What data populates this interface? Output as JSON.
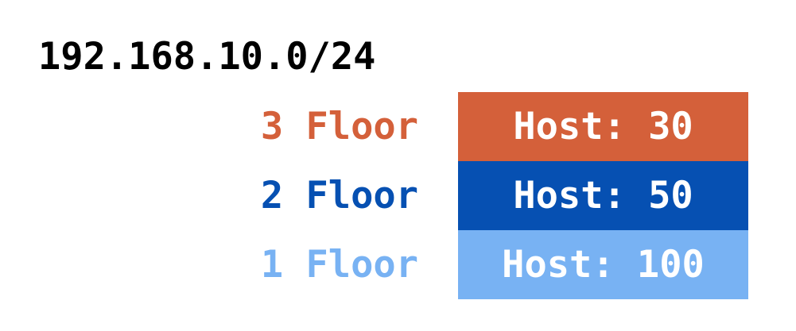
{
  "network": {
    "cidr": "192.168.10.0/24"
  },
  "floors": [
    {
      "label": "3 Floor",
      "host_text": "Host: 30",
      "color": "#d4603a"
    },
    {
      "label": "2 Floor",
      "host_text": "Host: 50",
      "color": "#0650b2"
    },
    {
      "label": "1 Floor",
      "host_text": "Host: 100",
      "color": "#78b2f3"
    }
  ]
}
